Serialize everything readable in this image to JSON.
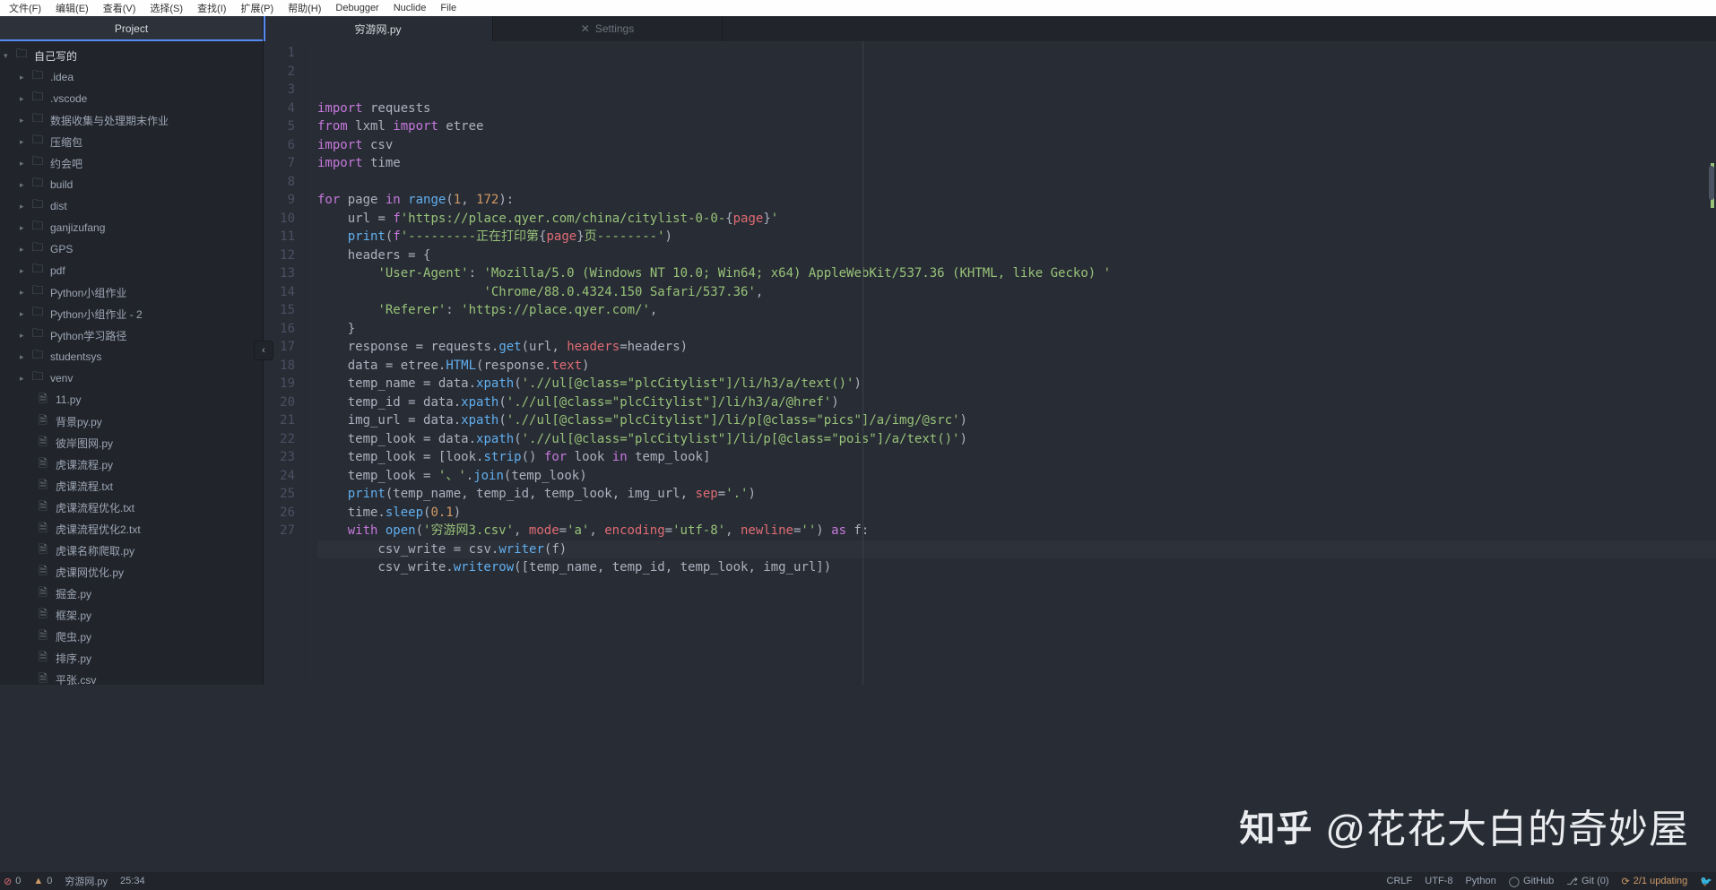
{
  "menu": [
    "文件(F)",
    "编辑(E)",
    "查看(V)",
    "选择(S)",
    "查找(I)",
    "扩展(P)",
    "帮助(H)",
    "Debugger",
    "Nuclide",
    "File"
  ],
  "sidebar": {
    "tab": "Project",
    "root": "自己写的",
    "folders": [
      ".idea",
      ".vscode",
      "数据收集与处理期末作业",
      "压缩包",
      "约会吧",
      "build",
      "dist",
      "ganjizufang",
      "GPS",
      "pdf",
      "Python小组作业",
      "Python小组作业 - 2",
      "Python学习路径",
      "studentsys",
      "venv"
    ],
    "files": [
      "11.py",
      "背景py.py",
      "彼岸图网.py",
      "虎课流程.py",
      "虎课流程.txt",
      "虎课流程优化.txt",
      "虎课流程优化2.txt",
      "虎课名称爬取.py",
      "虎课网优化.py",
      "掘金.py",
      "框架.py",
      "爬虫.py",
      "排序.py",
      "平张.csv"
    ]
  },
  "tabs": [
    {
      "label": "穷游网.py",
      "active": true,
      "icon": ""
    },
    {
      "label": "Settings",
      "active": false,
      "icon": "gear"
    }
  ],
  "code": {
    "lines": [
      [
        [
          "kw",
          "import"
        ],
        [
          "op",
          " requests"
        ]
      ],
      [
        [
          "kw",
          "from"
        ],
        [
          "op",
          " lxml "
        ],
        [
          "kw",
          "import"
        ],
        [
          "op",
          " etree"
        ]
      ],
      [
        [
          "kw",
          "import"
        ],
        [
          "op",
          " csv"
        ]
      ],
      [
        [
          "kw",
          "import"
        ],
        [
          "op",
          " time"
        ]
      ],
      [],
      [
        [
          "kw",
          "for"
        ],
        [
          "op",
          " page "
        ],
        [
          "kw",
          "in"
        ],
        [
          "op",
          " "
        ],
        [
          "fn",
          "range"
        ],
        [
          "op",
          "("
        ],
        [
          "num",
          "1"
        ],
        [
          "op",
          ", "
        ],
        [
          "num",
          "172"
        ],
        [
          "op",
          "):"
        ]
      ],
      [
        [
          "op",
          "    url "
        ],
        [
          "op",
          "="
        ],
        [
          "op",
          " "
        ],
        [
          "kw",
          "f"
        ],
        [
          "str",
          "'https://place.qyer.com/china/citylist-0-0-"
        ],
        [
          "op",
          "{"
        ],
        [
          "id",
          "page"
        ],
        [
          "op",
          "}"
        ],
        [
          "str",
          "'"
        ]
      ],
      [
        [
          "op",
          "    "
        ],
        [
          "fn",
          "print"
        ],
        [
          "op",
          "("
        ],
        [
          "kw",
          "f"
        ],
        [
          "str",
          "'---------正在打印第"
        ],
        [
          "op",
          "{"
        ],
        [
          "id",
          "page"
        ],
        [
          "op",
          "}"
        ],
        [
          "str",
          "页--------'"
        ],
        [
          "op",
          ")"
        ]
      ],
      [
        [
          "op",
          "    headers "
        ],
        [
          "op",
          "="
        ],
        [
          "op",
          " {"
        ]
      ],
      [
        [
          "op",
          "        "
        ],
        [
          "str",
          "'User-Agent'"
        ],
        [
          "op",
          ": "
        ],
        [
          "str",
          "'Mozilla/5.0 (Windows NT 10.0; Win64; x64) AppleWebKit/537.36 (KHTML, like Gecko) '"
        ]
      ],
      [
        [
          "op",
          "                      "
        ],
        [
          "str",
          "'Chrome/88.0.4324.150 Safari/537.36'"
        ],
        [
          "op",
          ","
        ]
      ],
      [
        [
          "op",
          "        "
        ],
        [
          "str",
          "'Referer'"
        ],
        [
          "op",
          ": "
        ],
        [
          "str",
          "'https://place.qyer.com/'"
        ],
        [
          "op",
          ","
        ]
      ],
      [
        [
          "op",
          "    }"
        ]
      ],
      [
        [
          "op",
          "    response "
        ],
        [
          "op",
          "="
        ],
        [
          "op",
          " requests."
        ],
        [
          "fn",
          "get"
        ],
        [
          "op",
          "(url, "
        ],
        [
          "id",
          "headers"
        ],
        [
          "op",
          "=headers)"
        ]
      ],
      [
        [
          "op",
          "    data "
        ],
        [
          "op",
          "="
        ],
        [
          "op",
          " etree."
        ],
        [
          "fn",
          "HTML"
        ],
        [
          "op",
          "(response."
        ],
        [
          "id",
          "text"
        ],
        [
          "op",
          ")"
        ]
      ],
      [
        [
          "op",
          "    temp_name "
        ],
        [
          "op",
          "="
        ],
        [
          "op",
          " data."
        ],
        [
          "fn",
          "xpath"
        ],
        [
          "op",
          "("
        ],
        [
          "str",
          "'.//ul[@class=\"plcCitylist\"]/li/h3/a/text()'"
        ],
        [
          "op",
          ")"
        ]
      ],
      [
        [
          "op",
          "    temp_id "
        ],
        [
          "op",
          "="
        ],
        [
          "op",
          " data."
        ],
        [
          "fn",
          "xpath"
        ],
        [
          "op",
          "("
        ],
        [
          "str",
          "'.//ul[@class=\"plcCitylist\"]/li/h3/a/@href'"
        ],
        [
          "op",
          ")"
        ]
      ],
      [
        [
          "op",
          "    img_url "
        ],
        [
          "op",
          "="
        ],
        [
          "op",
          " data."
        ],
        [
          "fn",
          "xpath"
        ],
        [
          "op",
          "("
        ],
        [
          "str",
          "'.//ul[@class=\"plcCitylist\"]/li/p[@class=\"pics\"]/a/img/@src'"
        ],
        [
          "op",
          ")"
        ]
      ],
      [
        [
          "op",
          "    temp_look "
        ],
        [
          "op",
          "="
        ],
        [
          "op",
          " data."
        ],
        [
          "fn",
          "xpath"
        ],
        [
          "op",
          "("
        ],
        [
          "str",
          "'.//ul[@class=\"plcCitylist\"]/li/p[@class=\"pois\"]/a/text()'"
        ],
        [
          "op",
          ")"
        ]
      ],
      [
        [
          "op",
          "    temp_look "
        ],
        [
          "op",
          "="
        ],
        [
          "op",
          " [look."
        ],
        [
          "fn",
          "strip"
        ],
        [
          "op",
          "() "
        ],
        [
          "kw",
          "for"
        ],
        [
          "op",
          " look "
        ],
        [
          "kw",
          "in"
        ],
        [
          "op",
          " temp_look]"
        ]
      ],
      [
        [
          "op",
          "    temp_look "
        ],
        [
          "op",
          "="
        ],
        [
          "op",
          " "
        ],
        [
          "str",
          "'、'"
        ],
        [
          "op",
          "."
        ],
        [
          "fn",
          "join"
        ],
        [
          "op",
          "(temp_look)"
        ]
      ],
      [
        [
          "op",
          "    "
        ],
        [
          "fn",
          "print"
        ],
        [
          "op",
          "(temp_name, temp_id, temp_look, img_url, "
        ],
        [
          "id",
          "sep"
        ],
        [
          "op",
          "="
        ],
        [
          "str",
          "'.'"
        ],
        [
          "op",
          ")"
        ]
      ],
      [
        [
          "op",
          "    time."
        ],
        [
          "fn",
          "sleep"
        ],
        [
          "op",
          "("
        ],
        [
          "num",
          "0.1"
        ],
        [
          "op",
          ")"
        ]
      ],
      [
        [
          "op",
          "    "
        ],
        [
          "kw",
          "with"
        ],
        [
          "op",
          " "
        ],
        [
          "fn",
          "open"
        ],
        [
          "op",
          "("
        ],
        [
          "str",
          "'穷游网3.csv'"
        ],
        [
          "op",
          ", "
        ],
        [
          "id",
          "mode"
        ],
        [
          "op",
          "="
        ],
        [
          "str",
          "'a'"
        ],
        [
          "op",
          ", "
        ],
        [
          "id",
          "encoding"
        ],
        [
          "op",
          "="
        ],
        [
          "str",
          "'utf-8'"
        ],
        [
          "op",
          ", "
        ],
        [
          "id",
          "newline"
        ],
        [
          "op",
          "="
        ],
        [
          "str",
          "''"
        ],
        [
          "op",
          ") "
        ],
        [
          "kw",
          "as"
        ],
        [
          "op",
          " f:"
        ]
      ],
      [
        [
          "op",
          "        csv_write "
        ],
        [
          "op",
          "="
        ],
        [
          "op",
          " csv."
        ],
        [
          "fn",
          "writer"
        ],
        [
          "op",
          "(f)"
        ]
      ],
      [
        [
          "op",
          "        csv_write."
        ],
        [
          "fn",
          "writerow"
        ],
        [
          "op",
          "([temp_name, temp_id, temp_look, img_url])"
        ]
      ],
      []
    ],
    "start": 1,
    "highlight": 25
  },
  "status": {
    "errors": "0",
    "warnings": "0",
    "file": "穷游网.py",
    "pos": "25:34",
    "eol": "CRLF",
    "enc": "UTF-8",
    "lang": "Python",
    "github": "GitHub",
    "git": "Git (0)",
    "fetch": "2/1 updating"
  },
  "watermark": {
    "logo": "知乎",
    "text": "@花花大白的奇妙屋"
  }
}
